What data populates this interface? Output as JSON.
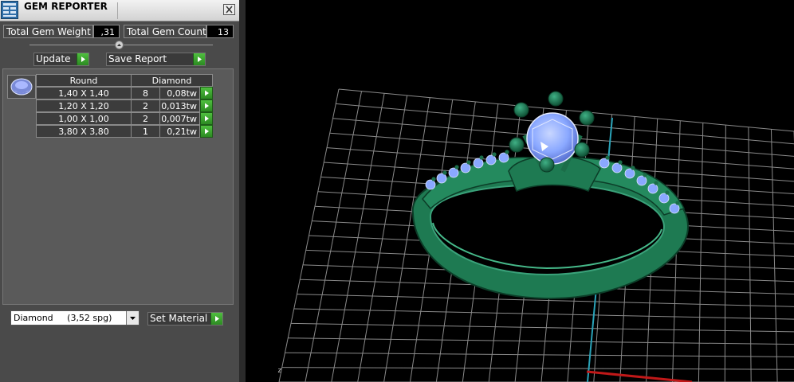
{
  "window": {
    "title": "GEM REPORTER",
    "close_icon": "close-icon"
  },
  "stats": {
    "total_weight_label": "Total Gem Weight",
    "total_weight_value": ",31",
    "total_count_label": "Total Gem Count",
    "total_count_value": "13"
  },
  "toolbar": {
    "update_label": "Update",
    "save_report_label": "Save Report"
  },
  "gem_group": {
    "icon": "round-gem-icon",
    "shape_header": "Round",
    "material_header": "Diamond",
    "rows": [
      {
        "size": "1,40 X 1,40",
        "count": "8",
        "weight": "0,08tw"
      },
      {
        "size": "1,20 X 1,20",
        "count": "2",
        "weight": "0,013tw"
      },
      {
        "size": "1,00 X 1,00",
        "count": "2",
        "weight": "0,007tw"
      },
      {
        "size": "3,80 X 3,80",
        "count": "1",
        "weight": "0,21tw"
      }
    ]
  },
  "material": {
    "selected": "Diamond     (3,52 spg)",
    "set_label": "Set Material"
  },
  "colors": {
    "accent_green": "#3aa82e",
    "ring_metal": "#1e7a52",
    "gem_blue": "#8aa8ff",
    "axis_cyan": "#2aa3b8",
    "axis_red": "#c01818"
  }
}
